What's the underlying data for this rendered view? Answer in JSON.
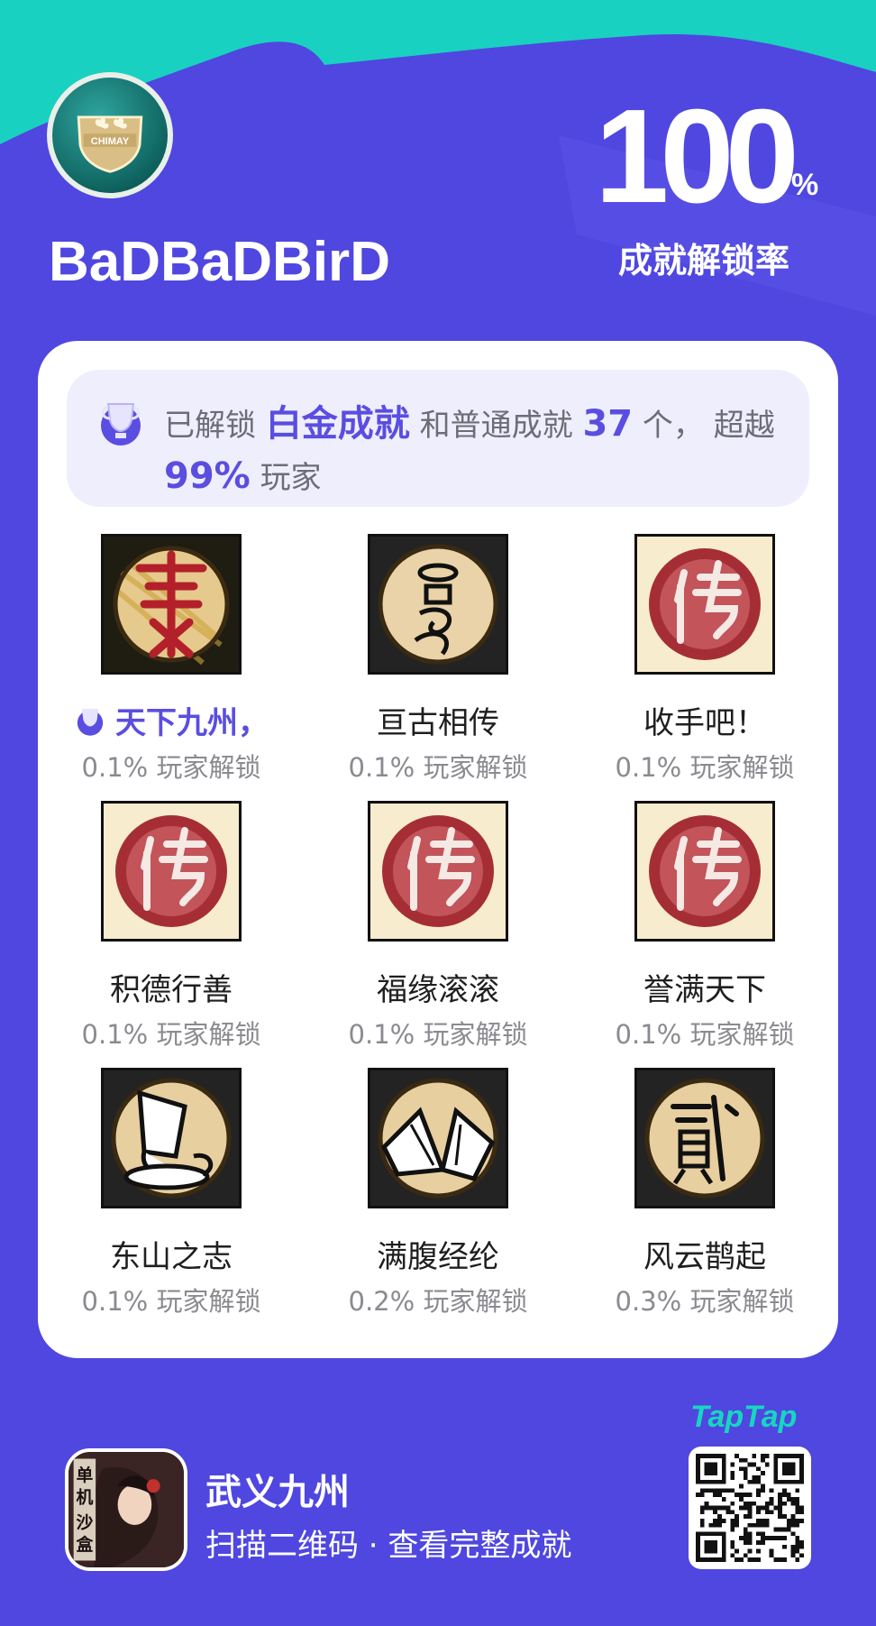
{
  "header": {
    "username": "BaDBaDBirD",
    "avatar_icon": "chimay-badge-icon",
    "avatar_text": "CHIMAY",
    "unlock_rate": "100",
    "unlock_rate_unit": "%",
    "unlock_rate_label": "成就解锁率"
  },
  "summary": {
    "prefix": "已解锁",
    "platinum": "白金成就",
    "middle": "和普通成就",
    "count": "37",
    "count_unit": "个，",
    "exceed_prefix": "超越",
    "percent": "99%",
    "suffix": "玩家"
  },
  "achievements": [
    {
      "name": "天下九州，",
      "pct": "0.1% 玩家解锁",
      "icon": "yi-character-icon",
      "platinum": true
    },
    {
      "name": "亘古相传",
      "pct": "0.1% 玩家解锁",
      "icon": "ancient-seal-icon",
      "platinum": false
    },
    {
      "name": "收手吧！",
      "pct": "0.1% 玩家解锁",
      "icon": "chuan-seal-icon",
      "platinum": false
    },
    {
      "name": "积德行善",
      "pct": "0.1% 玩家解锁",
      "icon": "chuan-seal-icon",
      "platinum": false
    },
    {
      "name": "福缘滚滚",
      "pct": "0.1% 玩家解锁",
      "icon": "chuan-seal-icon",
      "platinum": false
    },
    {
      "name": "誉满天下",
      "pct": "0.1% 玩家解锁",
      "icon": "chuan-seal-icon",
      "platinum": false
    },
    {
      "name": "东山之志",
      "pct": "0.1% 玩家解锁",
      "icon": "teapot-icon",
      "platinum": false
    },
    {
      "name": "满腹经纶",
      "pct": "0.2% 玩家解锁",
      "icon": "book-icon",
      "platinum": false
    },
    {
      "name": "风云鹊起",
      "pct": "0.3% 玩家解锁",
      "icon": "er-character-icon",
      "platinum": false
    }
  ],
  "footer": {
    "game_name": "武义九州",
    "scan_hint": "扫描二维码 · 查看完整成就",
    "brand": "TapTap",
    "game_logo_text": [
      "单",
      "机",
      "沙",
      "盒"
    ]
  },
  "colors": {
    "background": "#4f47e0",
    "accent_teal": "#19d1c0",
    "highlight": "#5a4ee0"
  }
}
